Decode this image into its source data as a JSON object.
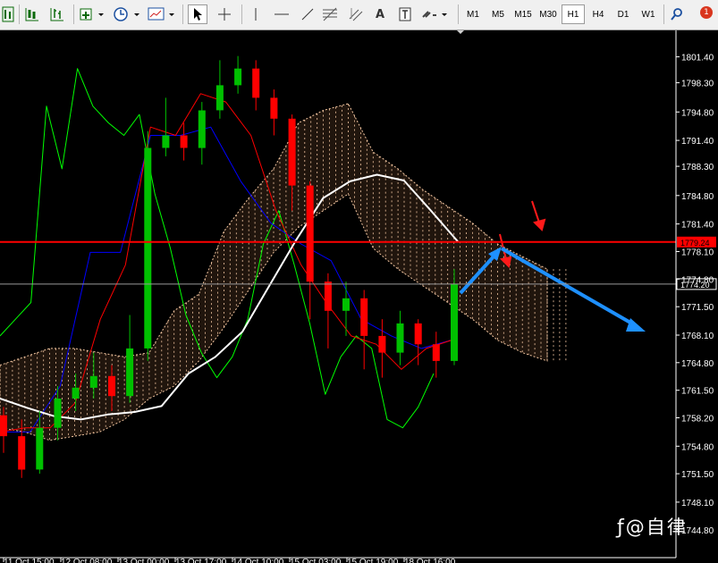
{
  "toolbar": {
    "timeframes": [
      "M1",
      "M5",
      "M15",
      "M30",
      "H1",
      "H4",
      "D1",
      "W1"
    ],
    "active_timeframe": "H1",
    "text_tool_label": "A",
    "notification_count": "1",
    "icons": [
      "bar-chart-icon",
      "candlestick-icon",
      "new-chart-icon",
      "clock-icon",
      "templates-icon",
      "cursor-icon",
      "crosshair-icon",
      "vertical-line-icon",
      "trendline-icon",
      "fibonacci-icon",
      "text-label-icon",
      "arrows-icon",
      "search-icon"
    ]
  },
  "chart_data": {
    "type": "line",
    "title": "",
    "symbol": "",
    "y_ticks": [
      "1801.40",
      "1798.30",
      "1794.80",
      "1791.40",
      "1788.30",
      "1784.80",
      "1781.40",
      "1778.10",
      "1774.80",
      "1771.50",
      "1768.10",
      "1764.80",
      "1761.50",
      "1758.20",
      "1754.80",
      "1751.50",
      "1748.10",
      "1744.80"
    ],
    "x_ticks": [
      "11 Oct 15:00",
      "12 Oct 08:00",
      "13 Oct 00:00",
      "13 Oct 17:00",
      "14 Oct 10:00",
      "15 Oct 03:00",
      "15 Oct 19:00",
      "18 Oct 16:00"
    ],
    "ylim": [
      1743.6,
      1803.5
    ],
    "price_levels": [
      {
        "label": "1779.24",
        "value": 1779.24,
        "color": "#ff0000"
      },
      {
        "label": "1774.20",
        "value": 1774.2,
        "color": "#9a9a9a"
      }
    ],
    "ichimoku_cloud_top": [
      1764.5,
      1765.5,
      1766.5,
      1766.5,
      1766.0,
      1765.5,
      1766.0,
      1771.0,
      1773.0,
      1780.5,
      1784.5,
      1788.0,
      1793.5,
      1795.0,
      1795.8,
      1790.0,
      1788.0,
      1785.5,
      1783.5,
      1781.5,
      1779.0,
      1777.5,
      1776.0
    ],
    "ichimoku_cloud_bottom": [
      1757.0,
      1756.5,
      1755.5,
      1756.0,
      1756.5,
      1758.0,
      1760.5,
      1762.0,
      1765.0,
      1769.0,
      1773.5,
      1778.0,
      1781.0,
      1783.0,
      1785.0,
      1778.5,
      1776.0,
      1774.0,
      1772.0,
      1770.0,
      1767.5,
      1766.0,
      1765.0
    ],
    "moving_average": [
      1760.5,
      1759.4,
      1758.4,
      1758.0,
      1758.6,
      1758.9,
      1759.6,
      1763.5,
      1765.5,
      1768.5,
      1774.0,
      1779.5,
      1784.5,
      1786.5,
      1787.3,
      1786.6,
      1783.0,
      1779.3
    ],
    "chikou_span": [
      1768.0,
      1770.0,
      1772.0,
      1795.5,
      1788.0,
      1800.0,
      1795.5,
      1793.5,
      1792.0,
      1794.5,
      1785.0,
      1778.5,
      1770.5,
      1766.0,
      1763.0,
      1765.5,
      1770.0,
      1779.0,
      1783.0,
      1776.5,
      1769.5,
      1761.0,
      1765.5,
      1768.0,
      1766.5,
      1758.0,
      1757.0,
      1759.5,
      1763.5
    ],
    "tenkan_sen": [
      1756.5,
      1757.0,
      1757.0,
      1760.0,
      1770.0,
      1776.5,
      1793.0,
      1792.0,
      1797.0,
      1796.0,
      1792.0,
      1783.0,
      1776.5,
      1772.0,
      1768.0,
      1767.0,
      1764.0,
      1766.5,
      1767.5
    ],
    "kijun_sen": [
      1756.5,
      1756.5,
      1762.0,
      1778.0,
      1778.0,
      1792.0,
      1792.0,
      1793.0,
      1786.5,
      1781.5,
      1779.0,
      1777.0,
      1770.0,
      1768.0,
      1766.5,
      1767.5
    ],
    "candles": [
      [
        1758.5,
        1756.0,
        1759.5,
        1754.0
      ],
      [
        1756.0,
        1752.0,
        1758.0,
        1751.0
      ],
      [
        1752.0,
        1757.0,
        1759.0,
        1751.5
      ],
      [
        1757.0,
        1760.5,
        1762.0,
        1755.5
      ],
      [
        1760.5,
        1761.8,
        1763.5,
        1759.0
      ],
      [
        1761.8,
        1763.2,
        1766.0,
        1760.5
      ],
      [
        1763.2,
        1760.8,
        1764.5,
        1759.0
      ],
      [
        1760.8,
        1766.5,
        1770.5,
        1760.0
      ],
      [
        1766.5,
        1790.5,
        1792.5,
        1765.0
      ],
      [
        1790.5,
        1792.0,
        1796.5,
        1789.5
      ],
      [
        1792.0,
        1790.5,
        1793.5,
        1789.0
      ],
      [
        1790.5,
        1795.0,
        1796.0,
        1788.5
      ],
      [
        1795.0,
        1798.0,
        1801.0,
        1794.0
      ],
      [
        1798.0,
        1800.0,
        1801.5,
        1797.0
      ],
      [
        1800.0,
        1796.5,
        1801.0,
        1795.0
      ],
      [
        1796.5,
        1794.0,
        1797.5,
        1792.0
      ],
      [
        1794.0,
        1786.0,
        1794.5,
        1783.0
      ],
      [
        1786.0,
        1774.5,
        1786.5,
        1770.0
      ],
      [
        1774.5,
        1771.0,
        1775.5,
        1766.5
      ],
      [
        1771.0,
        1772.5,
        1774.5,
        1768.0
      ],
      [
        1772.5,
        1768.0,
        1773.5,
        1764.0
      ],
      [
        1768.0,
        1766.0,
        1770.0,
        1763.0
      ],
      [
        1766.0,
        1769.5,
        1771.0,
        1764.5
      ],
      [
        1769.5,
        1767.0,
        1770.0,
        1764.5
      ],
      [
        1767.0,
        1765.0,
        1768.5,
        1763.0
      ],
      [
        1765.0,
        1774.2,
        1776.0,
        1764.5
      ]
    ],
    "colors": {
      "background": "#000000",
      "bull_candle": "#00c000",
      "bear_candle": "#ff0000",
      "moving_average": "#ffffff",
      "chikou_span": "#00ff00",
      "tenkan_sen": "#ff0000",
      "kijun_sen": "#0000ff",
      "cloud": "#f2c5a0",
      "annotation_red": "#ff1a1a",
      "annotation_blue": "#1e90ff"
    }
  },
  "watermark_text": "@自律"
}
